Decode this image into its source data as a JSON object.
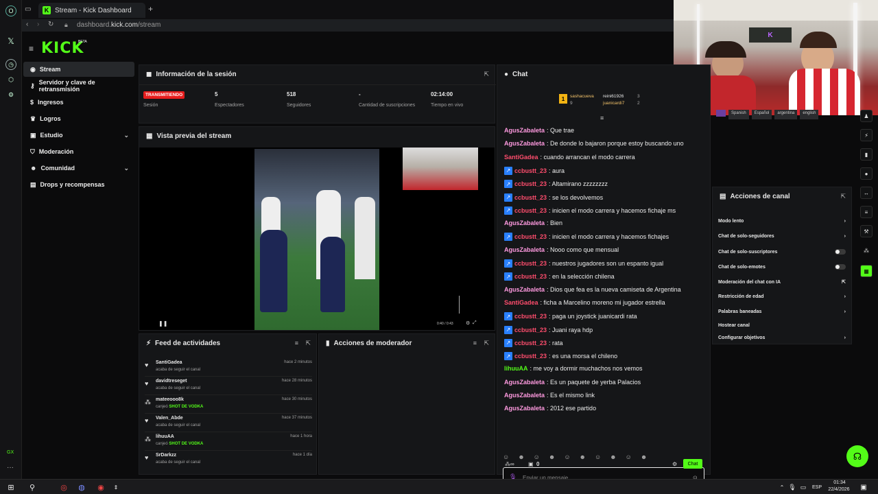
{
  "browser": {
    "tab_title": "Stream - Kick Dashboard",
    "url_prefix": "dashboard.",
    "url_host": "kick.com",
    "url_path": "/stream",
    "rail_label": "GX",
    "new_tab": "+"
  },
  "logo": {
    "text": "KICK",
    "beta": "BETA"
  },
  "sidebar": {
    "items": [
      {
        "label": "Stream",
        "icon": "broadcast-icon"
      },
      {
        "label": "Servidor y clave de retransmisión",
        "icon": "key-icon"
      },
      {
        "label": "Ingresos",
        "icon": "dollar-icon"
      },
      {
        "label": "Logros",
        "icon": "trophy-icon"
      },
      {
        "label": "Estudio",
        "icon": "studio-icon"
      },
      {
        "label": "Moderación",
        "icon": "shield-icon"
      },
      {
        "label": "Comunidad",
        "icon": "users-icon"
      },
      {
        "label": "Drops y recompensas",
        "icon": "gift-icon"
      }
    ]
  },
  "session": {
    "title": "Información de la sesión",
    "live_badge": "TRANSMITIENDO",
    "session_label": "Sesión",
    "viewers_value": "5",
    "viewers_label": "Espectadores",
    "followers_value": "518",
    "followers_label": "Seguidores",
    "subs_value": "-",
    "subs_label": "Cantidad de suscripciones",
    "time_value": "02:14:00",
    "time_label": "Tiempo en vivo"
  },
  "preview": {
    "title": "Vista previa del stream",
    "time": "0:40 / 0:43"
  },
  "feed": {
    "title": "Feed de actividades",
    "items": [
      {
        "user": "SantiGadea",
        "desc": "acaba de seguir el canal",
        "time": "hace 2 minutos"
      },
      {
        "user": "davidtreseget",
        "desc": "acaba de seguir el canal",
        "time": "hace 28 minutos"
      },
      {
        "user": "mateeooo8k",
        "desc_prefix": "canjeó",
        "reward": "SHOT DE VODKA",
        "time": "hace 30 minutos"
      },
      {
        "user": "Valen_Abde",
        "desc": "acaba de seguir el canal",
        "time": "hace 37 minutos"
      },
      {
        "user": "lihuuAA",
        "desc_prefix": "canjeó",
        "reward": "SHOT DE VODKA",
        "time": "hace 1 hora"
      },
      {
        "user": "SrDarkzz",
        "desc": "acaba de seguir el canal",
        "time": "hace 1 día"
      }
    ]
  },
  "mod": {
    "title": "Acciones de moderador"
  },
  "chat": {
    "title": "Chat",
    "leaderboard": {
      "first": "sashacueva",
      "first_count": "9",
      "second": "reini61926",
      "second_count": "3",
      "third": "juanicardi7",
      "third_count": "2"
    },
    "messages": [
      {
        "user": "AgusZabaleta",
        "text": ": Que trae",
        "color": "#ff9ae0"
      },
      {
        "user": "AgusZabaleta",
        "text": ": De donde lo bajaron porque estoy buscando uno",
        "color": "#ff9ae0"
      },
      {
        "user": "SantiGadea",
        "text": ": cuando arrancan el modo carrera",
        "color": "#ff4d6d"
      },
      {
        "user": "ccbustt_23",
        "text": ": aura",
        "color": "#ff4d6d",
        "badge": true
      },
      {
        "user": "ccbustt_23",
        "text": ": Altamirano zzzzzzzz",
        "color": "#ff4d6d",
        "badge": true
      },
      {
        "user": "ccbustt_23",
        "text": ": se los devolvemos",
        "color": "#ff4d6d",
        "badge": true
      },
      {
        "user": "ccbustt_23",
        "text": ": inicien el modo carrera y hacemos fichaje ms",
        "color": "#ff4d6d",
        "badge": true
      },
      {
        "user": "AgusZabaleta",
        "text": ": Bien",
        "color": "#ff9ae0"
      },
      {
        "user": "ccbustt_23",
        "text": ": inicien el modo carrera y hacemos fichajes",
        "color": "#ff4d6d",
        "badge": true
      },
      {
        "user": "AgusZabaleta",
        "text": ": Nooo como que mensual",
        "color": "#ff9ae0"
      },
      {
        "user": "ccbustt_23",
        "text": ": nuestros jugadores son un espanto igual",
        "color": "#ff4d6d",
        "badge": true
      },
      {
        "user": "ccbustt_23",
        "text": ": en la selección chilena",
        "color": "#ff4d6d",
        "badge": true
      },
      {
        "user": "AgusZabaleta",
        "text": ": Dios que fea es la nueva camiseta de Argentina",
        "color": "#ff9ae0"
      },
      {
        "user": "SantiGadea",
        "text": ": ficha a Marcelino moreno mi jugador estrella",
        "color": "#ff4d6d"
      },
      {
        "user": "ccbustt_23",
        "text": ": paga un joystick juanicardi rata",
        "color": "#ff4d6d",
        "badge": true
      },
      {
        "user": "ccbustt_23",
        "text": ": Juani raya hdp",
        "color": "#ff4d6d",
        "badge": true
      },
      {
        "user": "ccbustt_23",
        "text": ": rata",
        "color": "#ff4d6d",
        "badge": true
      },
      {
        "user": "ccbustt_23",
        "text": ": es una morsa el chileno",
        "color": "#ff4d6d",
        "badge": true
      },
      {
        "user": "lihuuAA",
        "text": ": me voy a dormir muchachos nos vemos",
        "color": "#53fc18"
      },
      {
        "user": "AgusZabaleta",
        "text": ": Es un paquete de yerba Palacios",
        "color": "#ff9ae0"
      },
      {
        "user": "AgusZabaleta",
        "text": ": Es el mismo link",
        "color": "#ff9ae0"
      },
      {
        "user": "AgusZabaleta",
        "text": ": 2012 ese partido",
        "color": "#ff9ae0"
      }
    ],
    "input_placeholder": "Enviar un mensaje",
    "points": "0",
    "send_label": "Chat"
  },
  "tags": [
    "Spanish",
    "Español",
    "argentina",
    "english"
  ],
  "actions": {
    "title": "Acciones de canal",
    "items": [
      {
        "label": "Modo lento",
        "kind": "chevron"
      },
      {
        "label": "Chat de solo-seguidores",
        "kind": "chevron"
      },
      {
        "label": "Chat de solo-suscriptores",
        "kind": "toggle"
      },
      {
        "label": "Chat de solo-emotes",
        "kind": "toggle"
      },
      {
        "label": "Moderación del chat con IA",
        "kind": "external"
      },
      {
        "label": "Restricción de edad",
        "kind": "chevron"
      },
      {
        "label": "Palabras baneadas",
        "kind": "chevron"
      },
      {
        "label": "Hostear canal",
        "kind": "none"
      },
      {
        "label": "Configurar objetivos",
        "kind": "chevron"
      }
    ]
  },
  "taskbar": {
    "time": "01:34",
    "date": "22/4/2026",
    "lang": "ESP"
  },
  "colors": {
    "accent": "#53fc18",
    "live": "#e61e1e",
    "panel": "#151618"
  }
}
